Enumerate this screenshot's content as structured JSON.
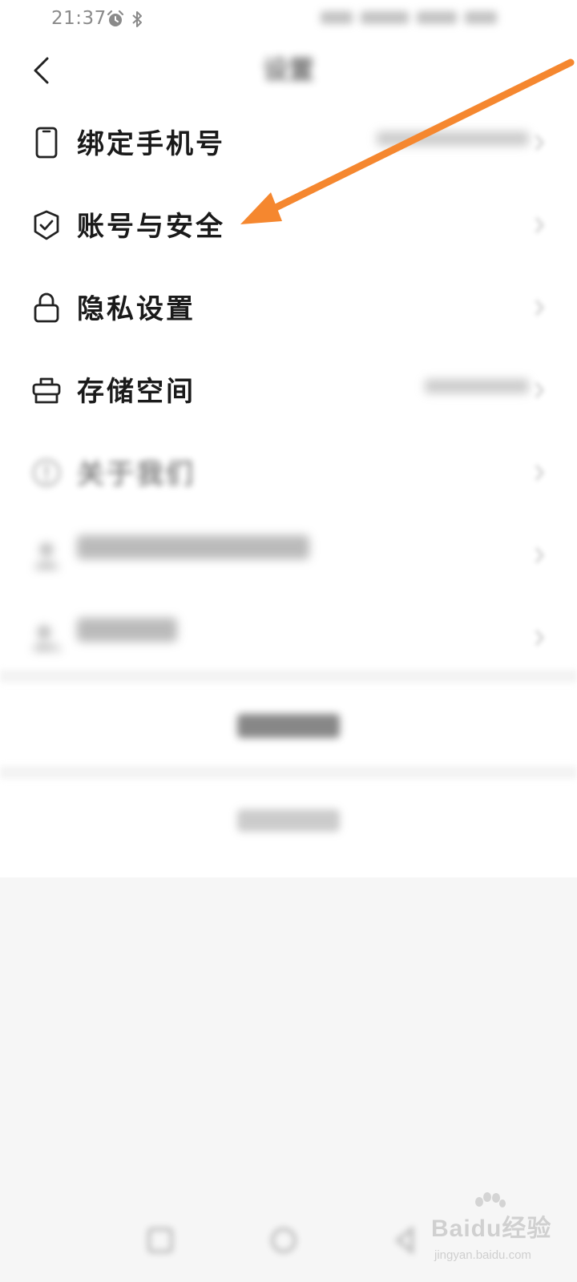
{
  "status_bar": {
    "time": "21:37",
    "icons": [
      "alarm-icon",
      "bluetooth-icon"
    ]
  },
  "header": {
    "title": "设置"
  },
  "menu": {
    "items": [
      {
        "label": "绑定手机号",
        "icon": "phone-icon"
      },
      {
        "label": "账号与安全",
        "icon": "shield-check-icon"
      },
      {
        "label": "隐私设置",
        "icon": "lock-icon"
      },
      {
        "label": "存储空间",
        "icon": "storage-box-icon"
      },
      {
        "label": "关于我们",
        "icon": "info-icon"
      }
    ]
  },
  "actions": {
    "switch_account": "",
    "logout": ""
  },
  "annotation": {
    "arrow_color": "#f5872f"
  },
  "watermark": {
    "main": "Baidu经验",
    "sub": "jingyan.baidu.com"
  },
  "colors": {
    "background": "#ffffff",
    "text": "#1a1a1a",
    "icon_stroke": "#222222",
    "arrow": "#f5872f"
  }
}
